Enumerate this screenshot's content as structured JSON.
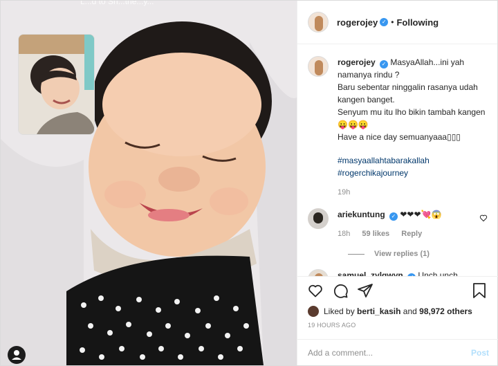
{
  "media": {
    "top_caption": "L...d to Sh...the...y...",
    "user_tag_icon": "person-icon",
    "colors": {
      "background": "#ece9ea",
      "blanket": "#121212",
      "skin": "#f0c4a4"
    }
  },
  "header": {
    "username": "rogerojey",
    "verified_icon": "verified-badge-icon",
    "separator": "•",
    "follow_label": "Following"
  },
  "caption": {
    "username": "rogerojey",
    "lines": [
      "MasyaAllah...ini yah namanya rindu ?",
      "Baru sebentar ninggalin rasanya udah kangen banget.",
      "Senyum mu itu lho bikin tambah kangen😛😛😛",
      "Have a nice day semuanyaaa▯▯▯"
    ],
    "hashtags": [
      "#masyaallahtabarakallah",
      "#rogerchikajourney"
    ],
    "time": "19h"
  },
  "comments": [
    {
      "username": "ariekuntung",
      "text": "❤❤❤💘😱",
      "time": "18h",
      "likes": "59 likes",
      "reply_label": "Reply",
      "view_replies": "View replies (1)"
    },
    {
      "username": "samuel_zylgwyn",
      "text": "Unch unch"
    }
  ],
  "actions": {
    "like_icon": "heart-icon",
    "comment_icon": "comment-icon",
    "share_icon": "share-icon",
    "save_icon": "bookmark-icon",
    "liked_prefix": "Liked by",
    "liked_user": "berti_kasih",
    "liked_and": "and",
    "liked_others": "98,972 others",
    "timestamp": "19 HOURS AGO"
  },
  "add_comment": {
    "placeholder": "Add a comment...",
    "post_label": "Post"
  }
}
